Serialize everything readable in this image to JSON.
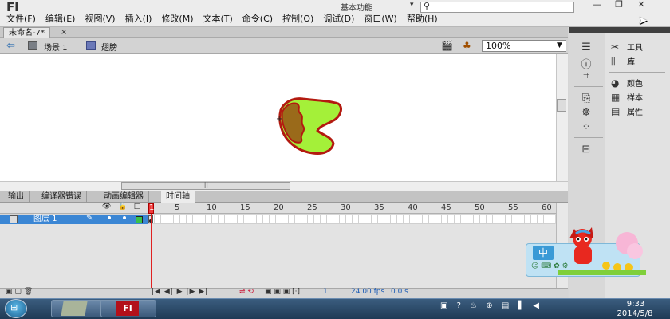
{
  "app": {
    "logo": "Fl",
    "workspace": "基本功能"
  },
  "menu": [
    "文件(F)",
    "编辑(E)",
    "视图(V)",
    "插入(I)",
    "修改(M)",
    "文本(T)",
    "命令(C)",
    "控制(O)",
    "调试(D)",
    "窗口(W)",
    "帮助(H)"
  ],
  "window_buttons": {
    "minimize": "—",
    "restore": "❐",
    "close": "✕"
  },
  "document": {
    "tab": "未命名-7*",
    "close": "×"
  },
  "breadcrumb": {
    "scene": "场景 1",
    "symbol": "翅膀"
  },
  "zoom": "100%",
  "panel_tabs": [
    "输出",
    "编译器错误",
    "动画编辑器",
    "时间轴"
  ],
  "timeline": {
    "layer_name": "图层 1",
    "frame_numbers": [
      "5",
      "10",
      "15",
      "20",
      "25",
      "30",
      "35",
      "40",
      "45",
      "50",
      "55",
      "60"
    ],
    "current_frame": "1",
    "playhead": "1",
    "fps": "24.00 fps",
    "time": "0.0 s"
  },
  "dock_panels": [
    {
      "icon": "tools-icon",
      "label": "工具"
    },
    {
      "icon": "library-icon",
      "label": "库"
    },
    {
      "icon": "color-icon",
      "label": "颜色"
    },
    {
      "icon": "swatches-icon",
      "label": "样本"
    },
    {
      "icon": "properties-icon",
      "label": "属性"
    }
  ],
  "ime": {
    "label": "中"
  },
  "clock": {
    "time": "9:33",
    "date": "2014/5/8"
  },
  "colors": {
    "accent": "#3b86d4",
    "wing_fill": "#a4f039",
    "wing_stroke": "#b31a10",
    "wing_inner": "#9a6a1a"
  }
}
